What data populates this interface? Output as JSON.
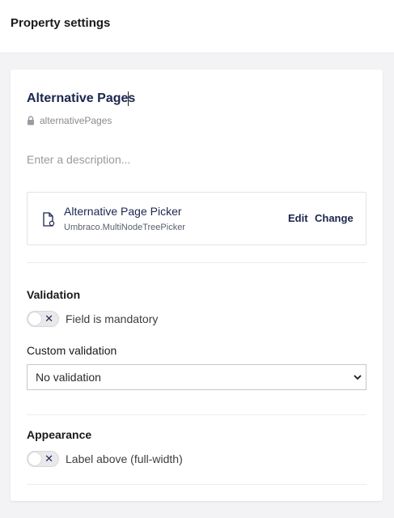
{
  "header": {
    "title": "Property settings"
  },
  "property": {
    "name": "Alternative Pages",
    "alias": "alternativePages",
    "description_placeholder": "Enter a description..."
  },
  "editor": {
    "name": "Alternative Page Picker",
    "alias": "Umbraco.MultiNodeTreePicker",
    "edit_label": "Edit",
    "change_label": "Change"
  },
  "validation": {
    "title": "Validation",
    "mandatory_label": "Field is mandatory",
    "mandatory_on": false,
    "custom_label": "Custom validation",
    "custom_value": "No validation"
  },
  "appearance": {
    "title": "Appearance",
    "label_above_label": "Label above (full-width)",
    "label_above_on": false
  },
  "colors": {
    "text_dark": "#1b264f",
    "toggle_off": "#e9e9ec"
  }
}
